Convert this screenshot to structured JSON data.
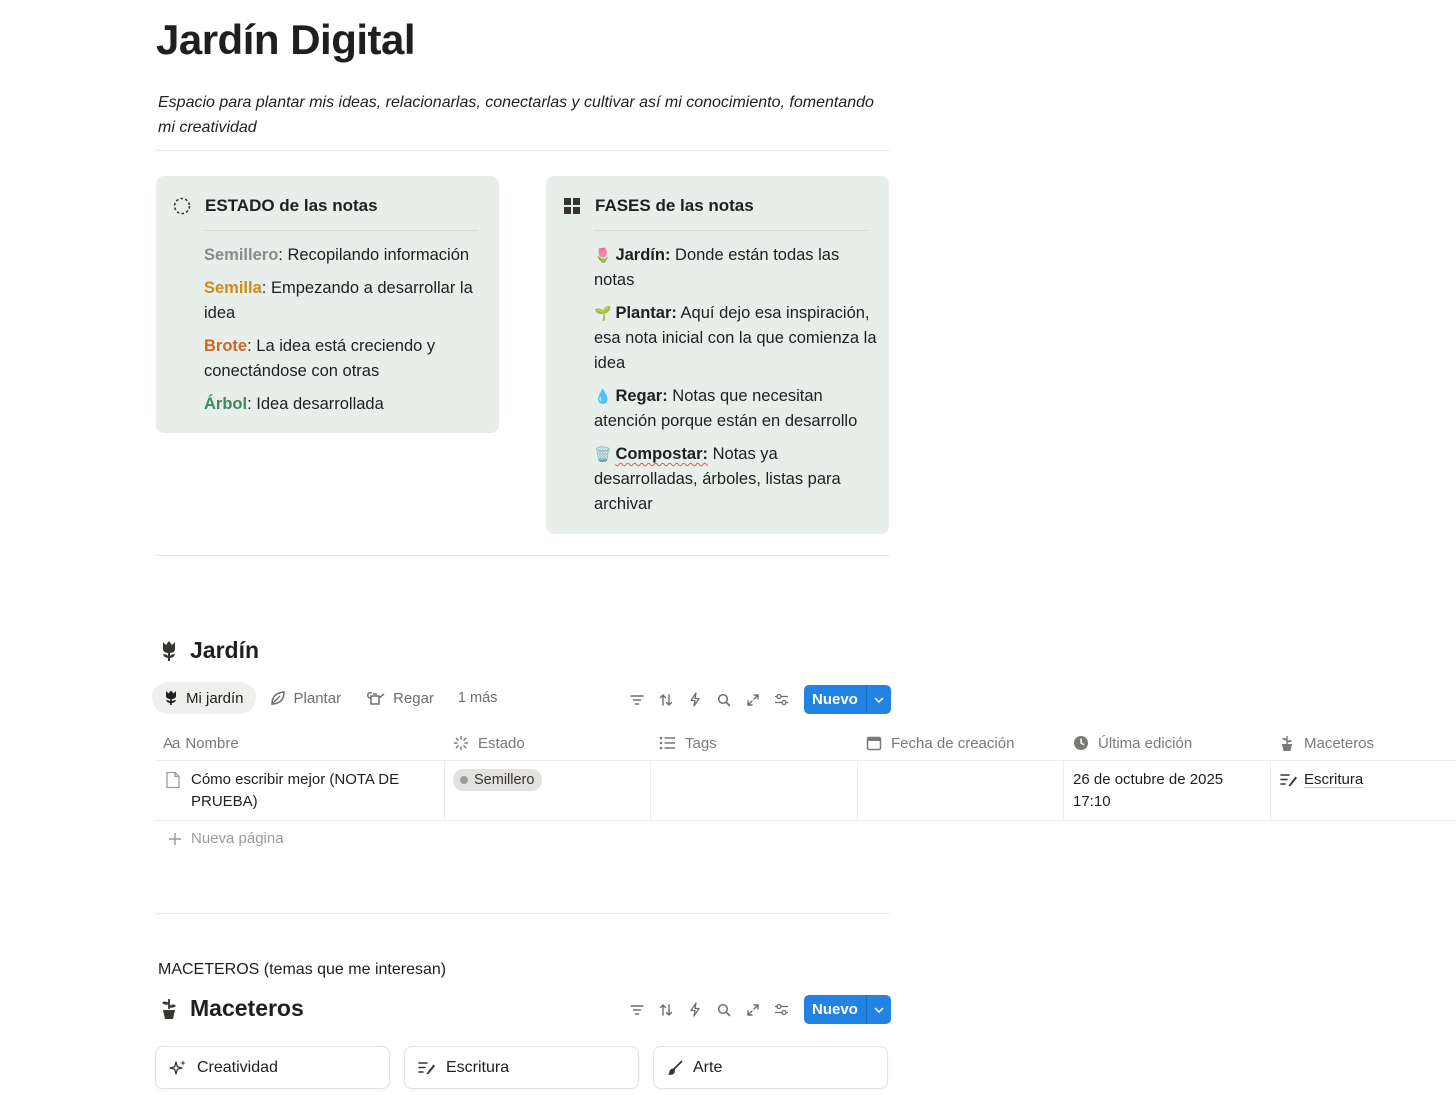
{
  "page": {
    "title": "Jardín Digital",
    "subtitle": "Espacio para plantar mis ideas, relacionarlas, conectarlas y cultivar así mi conocimiento, fomentando mi creatividad"
  },
  "estado": {
    "title": "ESTADO de las notas",
    "items": [
      {
        "key": "Semillero",
        "text": ": Recopilando información"
      },
      {
        "key": "Semilla",
        "text": ": Empezando a desarrollar la idea"
      },
      {
        "key": "Brote",
        "text": ": La idea está creciendo y conectándose con otras"
      },
      {
        "key": "Árbol",
        "text": ": Idea desarrollada"
      }
    ]
  },
  "fases": {
    "title": "FASES de las notas",
    "items": [
      {
        "emoji": "🌷",
        "key": "Jardín:",
        "text": " Donde están todas las notas"
      },
      {
        "emoji": "🌱",
        "key": "Plantar:",
        "text": " Aquí dejo esa inspiración, esa nota inicial con la que comienza la idea"
      },
      {
        "emoji": "💧",
        "key": "Regar:",
        "text": " Notas que necesitan atención porque están en desarrollo"
      },
      {
        "emoji": "🗑️",
        "key": "Compostar:",
        "text": " Notas ya desarrolladas, árboles, listas para archivar"
      }
    ]
  },
  "jardin": {
    "title": "Jardín",
    "tabs": [
      "Mi jardín",
      "Plantar",
      "Regar"
    ],
    "more": "1 más",
    "new_label": "Nuevo",
    "columns": [
      "Nombre",
      "Estado",
      "Tags",
      "Fecha de creación",
      "Última edición",
      "Maceteros"
    ],
    "rows": [
      {
        "nombre": "Cómo escribir mejor (NOTA DE PRUEBA)",
        "estado": "Semillero",
        "tags": "",
        "fecha": "",
        "ultima": "26 de octubre de 2025 17:10",
        "macetero": "Escritura"
      }
    ],
    "new_page": "Nueva página"
  },
  "maceteros": {
    "caption": "MACETEROS (temas que me interesan)",
    "title": "Maceteros",
    "new_label": "Nuevo",
    "cards": [
      "Creatividad",
      "Escritura",
      "Arte"
    ]
  },
  "colors": {
    "accent": "#2383e2",
    "callout_bg": "#e8efeb",
    "semillero": "#8a8a8a",
    "semilla": "#d18a17",
    "brote": "#d2661f",
    "arbol": "#3d8a5c"
  },
  "icons": {
    "estado": "dashed-circle-icon",
    "fases": "grid-icon",
    "jardin_db": "tulip-icon",
    "maceteros_db": "potted-plant-icon"
  }
}
